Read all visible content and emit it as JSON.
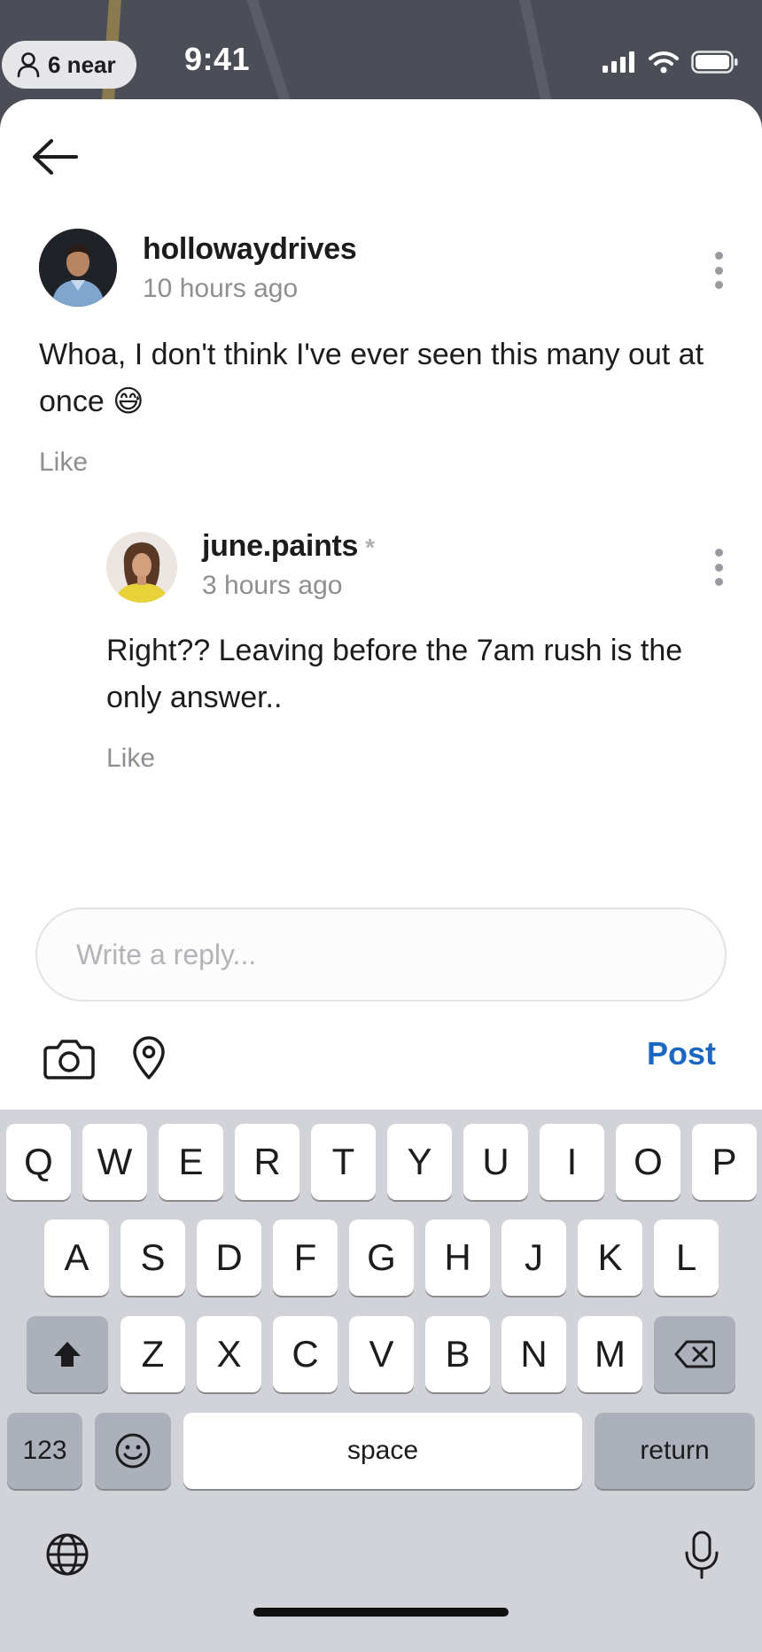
{
  "status_bar": {
    "nearby_label": "6 near",
    "time": "9:41"
  },
  "thread": {
    "back_icon": "arrow-left-icon",
    "comments": [
      {
        "username": "hollowaydrives",
        "timestamp": "10 hours ago",
        "text": "Whoa, I don't think I've ever seen this many out at once 😅",
        "like_label": "Like"
      },
      {
        "username": "june.paints",
        "badge": "*",
        "timestamp": "3 hours ago",
        "text": "Right?? Leaving before the 7am rush is the only answer..",
        "like_label": "Like"
      }
    ]
  },
  "composer": {
    "placeholder": "Write a reply...",
    "post_label": "Post",
    "camera_icon": "camera-icon",
    "location_icon": "location-pin-icon"
  },
  "keyboard": {
    "row1": [
      "Q",
      "W",
      "E",
      "R",
      "T",
      "Y",
      "U",
      "I",
      "O",
      "P"
    ],
    "row2": [
      "A",
      "S",
      "D",
      "F",
      "G",
      "H",
      "J",
      "K",
      "L"
    ],
    "row3": [
      "Z",
      "X",
      "C",
      "V",
      "B",
      "N",
      "M"
    ],
    "numbers_label": "123",
    "space_label": "space",
    "return_label": "return"
  },
  "colors": {
    "accent": "#1d67c4",
    "muted_text": "#8e8e93",
    "keyboard_bg": "#d1d3d9"
  }
}
